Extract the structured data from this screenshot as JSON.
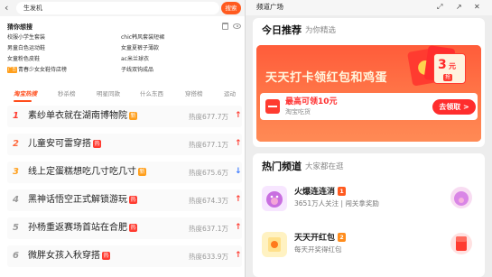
{
  "left": {
    "search": {
      "query": "生发机",
      "button_label": "搜索"
    },
    "guess": {
      "title": "猜你想搜",
      "items": [
        {
          "text": "校服小学生套装",
          "ad": false
        },
        {
          "text": "chic韩风套装短裙",
          "ad": false
        },
        {
          "text": "男童白色运动鞋",
          "ad": false
        },
        {
          "text": "女童夏裤子薄款",
          "ad": false
        },
        {
          "text": "女童粉色皮鞋",
          "ad": false
        },
        {
          "text": "ac米兰球衣",
          "ad": false
        },
        {
          "text": "青春少女女鞋侍店榜",
          "ad": true,
          "ad_label": "广告"
        },
        {
          "text": "子线双钩成品",
          "ad": false
        }
      ]
    },
    "tabs": [
      {
        "label": "淘宝热搜",
        "active": true
      },
      {
        "label": "秒杀榜",
        "active": false
      },
      {
        "label": "明星同款",
        "active": false
      },
      {
        "label": "什么东西",
        "active": false
      },
      {
        "label": "穿搭榜",
        "active": false
      },
      {
        "label": "运动",
        "active": false
      }
    ],
    "ranking": [
      {
        "rank": "1",
        "title": "素纱单衣就在湖南博物院",
        "badge": "新",
        "badge_color": "#ff9f1c",
        "heat": "热度677.7万",
        "trend": "up",
        "rank_color": "#ff3b30"
      },
      {
        "rank": "2",
        "title": "儿童安可雷穿搭",
        "badge": "热",
        "badge_color": "#ff3b30",
        "heat": "热度677.1万",
        "trend": "up",
        "rank_color": "#ff6a3d"
      },
      {
        "rank": "3",
        "title": "线上定蛋糕想吃几寸吃几寸",
        "badge": "新",
        "badge_color": "#ff9f1c",
        "heat": "热度675.6万",
        "trend": "down",
        "rank_color": "#ff9f1c"
      },
      {
        "rank": "4",
        "title": "黑神话悟空正式解锁游玩",
        "badge": "热",
        "badge_color": "#ff3b30",
        "heat": "热度674.3万",
        "trend": "up",
        "rank_color": "#999999"
      },
      {
        "rank": "5",
        "title": "孙杨重返赛场首站在合肥",
        "badge": "热",
        "badge_color": "#ff3b30",
        "heat": "热度637.1万",
        "trend": "up",
        "rank_color": "#999999"
      },
      {
        "rank": "6",
        "title": "微胖女孩入秋穿搭",
        "badge": "热",
        "badge_color": "#ff3b30",
        "heat": "热度633.9万",
        "trend": "up",
        "rank_color": "#999999"
      }
    ]
  },
  "right": {
    "header_title": "频道广场",
    "today": {
      "title": "今日推荐",
      "subtitle": "为你精选",
      "promo_title": "天天打卡领红包和鸡蛋",
      "coupon_value": "3",
      "coupon_unit": "元",
      "coupon_tag": "抢",
      "max_label": "最高可领10元",
      "source_label": "淘宝吃货",
      "claim_label": "去领取 >"
    },
    "hot": {
      "title": "热门频道",
      "subtitle": "大家都在逛",
      "channels": [
        {
          "name": "火爆连连消",
          "rank": "1",
          "desc": "3651万人关注 | 闯关拿奖励",
          "avatar_color": "#f7e6ff",
          "right_color": "#f8dcf2"
        },
        {
          "name": "天天开红包",
          "rank": "2",
          "desc": "每天开奖得红包",
          "avatar_color": "#fff2c2",
          "right_color": "#ffe1e1"
        }
      ]
    }
  }
}
